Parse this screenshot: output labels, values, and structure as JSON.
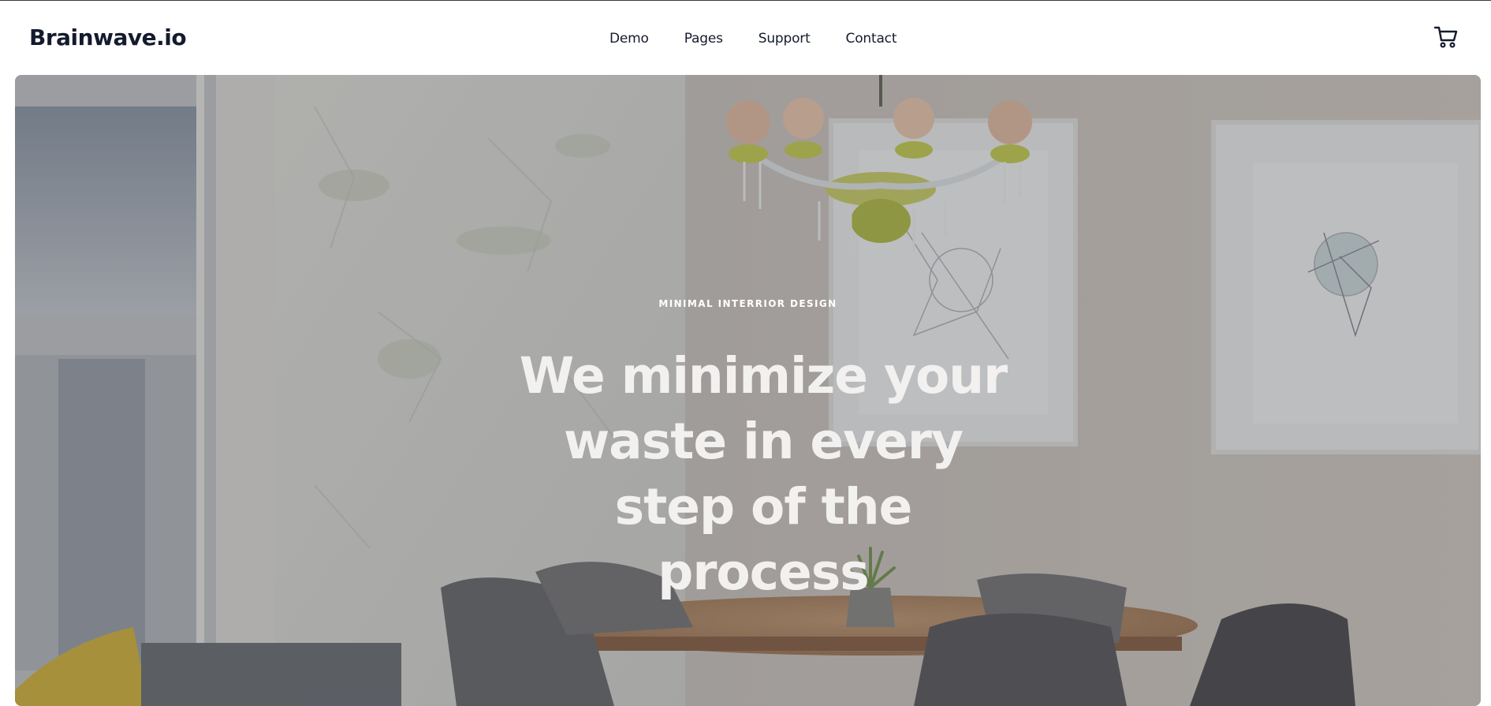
{
  "header": {
    "logo": "Brainwave.io",
    "nav": [
      {
        "label": "Demo"
      },
      {
        "label": "Pages"
      },
      {
        "label": "Support"
      },
      {
        "label": "Contact"
      }
    ],
    "cart_icon": "shopping-cart-icon"
  },
  "hero": {
    "eyebrow": "MINIMAL INTERRIOR DESIGN",
    "headline": "We minimize your waste in every step of the process",
    "background": "interior-photo: concrete wall, chandelier, framed art, round wooden table with grey chairs, potted succulent"
  },
  "colors": {
    "text_dark": "#151b2e",
    "hero_text": "#ffffff"
  }
}
